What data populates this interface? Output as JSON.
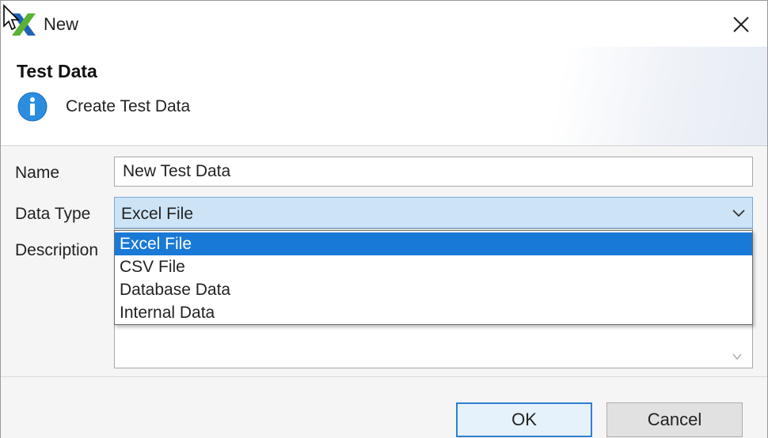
{
  "window": {
    "title": "New",
    "logo_icon": "x-app-logo-icon",
    "close_icon": "close-icon"
  },
  "banner": {
    "title": "Test Data",
    "message": "Create Test Data",
    "icon": "info-icon"
  },
  "form": {
    "name_label": "Name",
    "name_value": "New Test Data",
    "data_type_label": "Data Type",
    "data_type_value": "Excel File",
    "description_label": "Description",
    "data_type_options": [
      {
        "label": "Excel File",
        "selected": true
      },
      {
        "label": "CSV File",
        "selected": false
      },
      {
        "label": "Database Data",
        "selected": false
      },
      {
        "label": "Internal Data",
        "selected": false
      }
    ]
  },
  "buttons": {
    "ok_label": "OK",
    "cancel_label": "Cancel"
  },
  "colors": {
    "selection": "#1979d6",
    "select_bg": "#cde4f7",
    "default_button_border": "#2f7fd4",
    "logo_green": "#5ab335",
    "logo_blue": "#1e63b5",
    "info_blue": "#2a8de0"
  }
}
